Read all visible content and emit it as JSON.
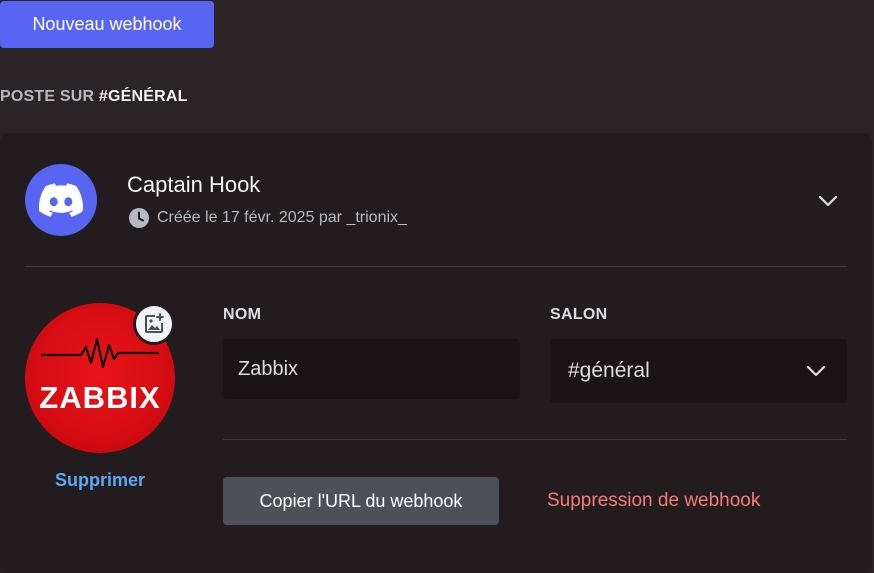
{
  "toolbar": {
    "new_webhook_label": "Nouveau webhook"
  },
  "section": {
    "heading_prefix": "POSTE SUR ",
    "heading_channel": "#GÉNÉRAL"
  },
  "webhook": {
    "name": "Captain Hook",
    "created_text": "Créée le 17 févr. 2025 par _trionix_",
    "avatar_text": "ZABBIX",
    "remove_avatar_label": "Supprimer",
    "name_field_label": "NOM",
    "name_value": "Zabbix",
    "channel_field_label": "SALON",
    "channel_value": "#général",
    "copy_url_label": "Copier l'URL du webhook",
    "delete_label": "Suppression de webhook"
  },
  "colors": {
    "accent": "#5865f2",
    "danger": "#f57b7b",
    "link": "#5ba8f5",
    "avatar_red": "#d40c12",
    "background": "#2b2426",
    "card": "#231c1e"
  },
  "icons": {
    "header_avatar": "discord-logo-icon",
    "created": "clock-icon",
    "expand": "chevron-down-icon",
    "add_image": "add-image-icon",
    "select": "chevron-down-icon"
  }
}
